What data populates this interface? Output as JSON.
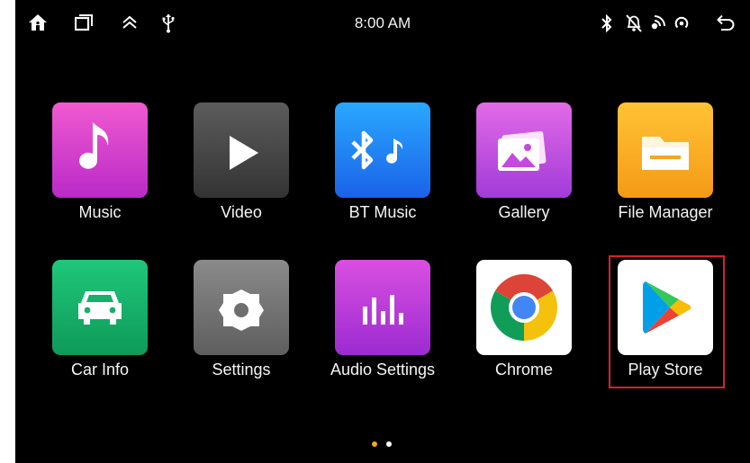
{
  "status_bar": {
    "time": "8:00 AM",
    "left_icons": [
      "home-icon",
      "recent-apps-icon",
      "expand-up-icon",
      "usb-icon"
    ],
    "right_icons": [
      "bluetooth-icon",
      "mute-icon",
      "wifi-hotspot-icon",
      "signal-icon",
      "back-icon"
    ]
  },
  "apps": [
    {
      "label": "Music",
      "icon": "music-note-icon",
      "color_top": "#f05ad0",
      "color_bottom": "#b92ac8"
    },
    {
      "label": "Video",
      "icon": "play-icon",
      "color_top": "#5c5c5c",
      "color_bottom": "#333333"
    },
    {
      "label": "BT Music",
      "icon": "bluetooth-music-icon",
      "color_top": "#2aa8ff",
      "color_bottom": "#1a62e8"
    },
    {
      "label": "Gallery",
      "icon": "gallery-icon",
      "color_top": "#e26ae6",
      "color_bottom": "#a23bd9"
    },
    {
      "label": "File Manager",
      "icon": "folder-icon",
      "color_top": "#ffc335",
      "color_bottom": "#f59a17"
    },
    {
      "label": "Car Info",
      "icon": "car-icon",
      "color_top": "#1fc77a",
      "color_bottom": "#0e9a5a"
    },
    {
      "label": "Settings",
      "icon": "gear-icon",
      "color_top": "#8a8a8a",
      "color_bottom": "#5e5e5e"
    },
    {
      "label": "Audio Settings",
      "icon": "equalizer-icon",
      "color_top": "#d94fe0",
      "color_bottom": "#9c2bd2"
    },
    {
      "label": "Chrome",
      "icon": "chrome-icon",
      "color_top": "#ffffff",
      "color_bottom": "#ffffff"
    },
    {
      "label": "Play Store",
      "icon": "play-store-icon",
      "color_top": "#ffffff",
      "color_bottom": "#ffffff"
    }
  ],
  "highlighted_app": "Play Store",
  "page_indicator": {
    "pages": 2,
    "current": 1,
    "active_color": "#f5a623",
    "inactive_color": "#ffffff"
  }
}
